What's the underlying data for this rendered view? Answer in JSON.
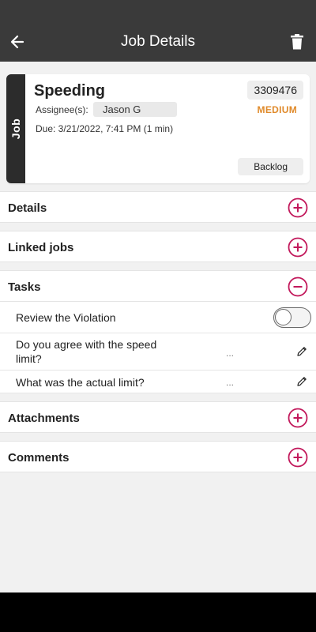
{
  "app_bar": {
    "title": "Job Details",
    "back_icon": "arrow-left-icon",
    "delete_icon": "trash-icon"
  },
  "job": {
    "tab_label": "Job",
    "title": "Speeding",
    "id": "3309476",
    "priority": "MEDIUM",
    "assignee_label": "Assignee(s):",
    "assignee": "Jason G",
    "due": "Due: 3/21/2022, 7:41 PM (1 min)",
    "status": "Backlog"
  },
  "sections": {
    "details": "Details",
    "linked_jobs": "Linked jobs",
    "tasks": "Tasks",
    "attachments": "Attachments",
    "comments": "Comments"
  },
  "tasks": [
    {
      "label": "Review the Violation",
      "type": "toggle",
      "value": false
    },
    {
      "label": "Do you agree with the speed limit?",
      "type": "text",
      "value": "..."
    },
    {
      "label": "What was the actual limit?",
      "type": "text",
      "value": "..."
    }
  ],
  "colors": {
    "accent": "#c2185b",
    "priority": "#e08a2a",
    "header": "#3a3a3a"
  }
}
